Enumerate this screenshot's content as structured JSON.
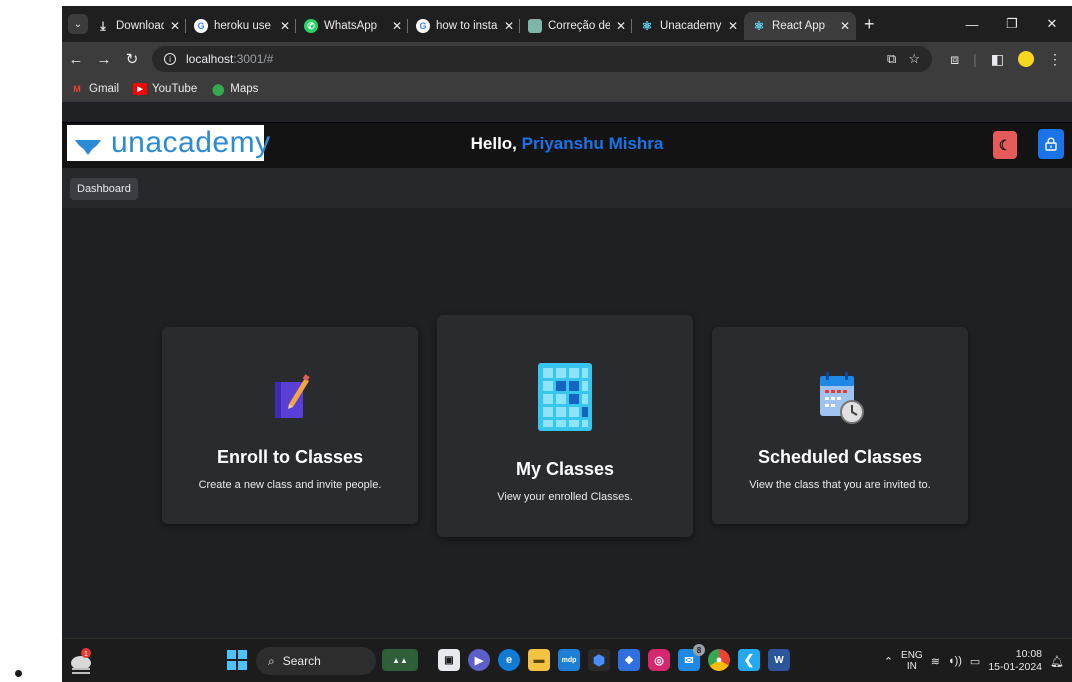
{
  "browser": {
    "tabs": [
      {
        "title": "Downloads",
        "icon": "download-icon",
        "active": false
      },
      {
        "title": "heroku use - (",
        "icon": "google-icon",
        "active": false
      },
      {
        "title": "WhatsApp",
        "icon": "whatsapp-icon",
        "active": false
      },
      {
        "title": "how to install",
        "icon": "google-icon",
        "active": false
      },
      {
        "title": "Correção de c",
        "icon": "app-icon",
        "active": false
      },
      {
        "title": "Unacademy E",
        "icon": "react-icon",
        "active": false
      },
      {
        "title": "React App",
        "icon": "react-icon",
        "active": true
      }
    ],
    "new_tab": "+",
    "address": {
      "host": "localhost",
      "path": ":3001/#"
    },
    "bookmarks": [
      {
        "label": "Gmail",
        "icon": "gmail-icon"
      },
      {
        "label": "YouTube",
        "icon": "youtube-icon"
      },
      {
        "label": "Maps",
        "icon": "maps-icon"
      }
    ]
  },
  "app": {
    "logo_text": "unacademy",
    "greeting_prefix": "Hello,",
    "user_name": "Priyanshu Mishra",
    "nav": {
      "dashboard_label": "Dashboard"
    },
    "cards": [
      {
        "title": "Enroll to Classes",
        "description": "Create a new class and invite people.",
        "icon": "edit-book-icon"
      },
      {
        "title": "My Classes",
        "description": "View your enrolled Classes.",
        "icon": "grid-icon"
      },
      {
        "title": "Scheduled Classes",
        "description": "View the class that you are invited to.",
        "icon": "calendar-clock-icon"
      }
    ],
    "colors": {
      "accent": "#1a73e8",
      "theme_button": "#e55a5a",
      "background": "#1f2023",
      "card": "#2a2b2f"
    }
  },
  "taskbar": {
    "search_placeholder": "Search",
    "weather_badge": "1",
    "mail_badge": "8",
    "tray": {
      "lang_1": "ENG",
      "lang_2": "IN",
      "time": "10:08",
      "date": "15-01-2024"
    }
  }
}
